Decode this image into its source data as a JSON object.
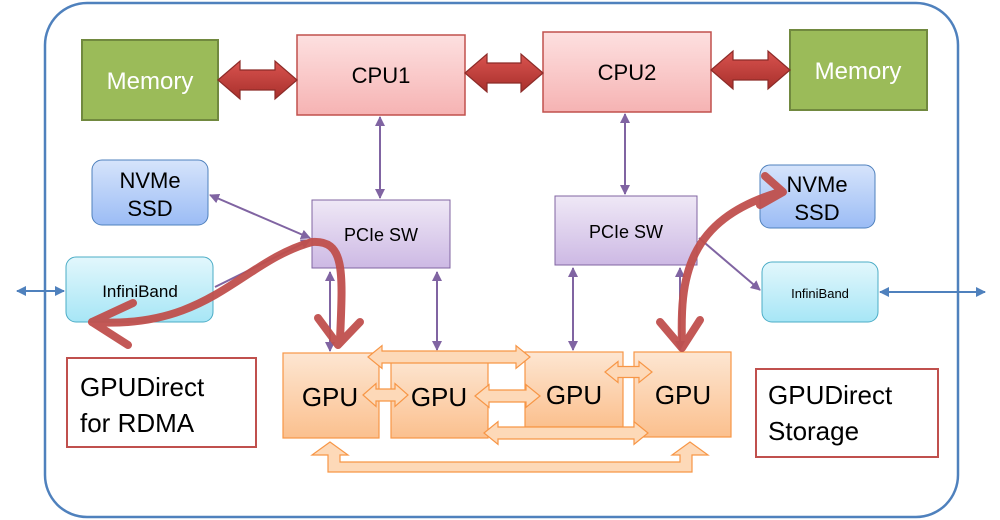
{
  "nodes": {
    "memory_left": "Memory",
    "memory_right": "Memory",
    "cpu1": "CPU1",
    "cpu2": "CPU2",
    "nvme_left": [
      "NVMe",
      "SSD"
    ],
    "nvme_right": [
      "NVMe",
      "SSD"
    ],
    "infiniband_left": "InfiniBand",
    "infiniband_right": "InfiniBand",
    "pcie_left": "PCIe SW",
    "pcie_right": "PCIe SW",
    "gpus": [
      "GPU",
      "GPU",
      "GPU",
      "GPU"
    ]
  },
  "labels": {
    "rdma": [
      "GPUDirect",
      "for RDMA"
    ],
    "storage": [
      "GPUDirect",
      "Storage"
    ]
  },
  "colors": {
    "frame": "#4f81bd",
    "memory": "#9bbb59",
    "cpu": "#f8c3c3",
    "pcie": "#dcd0ec",
    "link": "#8064a2",
    "gpu": "#fbc9a0",
    "data_path": "#c0504d"
  }
}
